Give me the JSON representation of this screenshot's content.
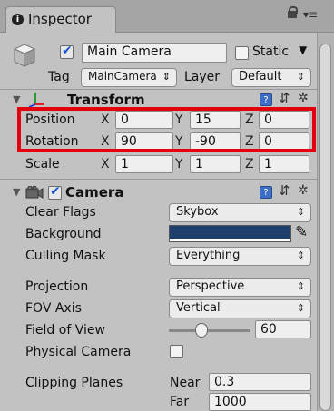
{
  "tab": {
    "label": "Inspector"
  },
  "header": {
    "name_value": "Main Camera",
    "static_label": "Static",
    "tag_label": "Tag",
    "tag_value": "MainCamera",
    "layer_label": "Layer",
    "layer_value": "Default"
  },
  "transform": {
    "title": "Transform",
    "position": {
      "label": "Position",
      "x": "0",
      "y": "15",
      "z": "0"
    },
    "rotation": {
      "label": "Rotation",
      "x": "90",
      "y": "-90",
      "z": "0"
    },
    "scale": {
      "label": "Scale",
      "x": "1",
      "y": "1",
      "z": "1"
    }
  },
  "camera": {
    "title": "Camera",
    "clear_flags": {
      "label": "Clear Flags",
      "value": "Skybox"
    },
    "background": {
      "label": "Background",
      "color": "#1e3f6d"
    },
    "culling_mask": {
      "label": "Culling Mask",
      "value": "Everything"
    },
    "projection": {
      "label": "Projection",
      "value": "Perspective"
    },
    "fov_axis": {
      "label": "FOV Axis",
      "value": "Vertical"
    },
    "field_of_view": {
      "label": "Field of View",
      "value": "60"
    },
    "physical_camera": {
      "label": "Physical Camera"
    },
    "clipping_planes": {
      "label": "Clipping Planes",
      "near_label": "Near",
      "near_value": "0.3",
      "far_label": "Far",
      "far_value": "1000"
    }
  },
  "axes": {
    "x": "X",
    "y": "Y",
    "z": "Z"
  },
  "icons": {
    "tab": "info-icon",
    "lock": "lock-icon",
    "menu": "menu-icon",
    "gameobject": "cube-icon",
    "transform": "transform-axes-icon",
    "camera": "camera-icon",
    "help": "help-icon",
    "presets": "sliders-icon",
    "settings": "gear-icon",
    "eyedropper": "eyedropper-icon"
  }
}
